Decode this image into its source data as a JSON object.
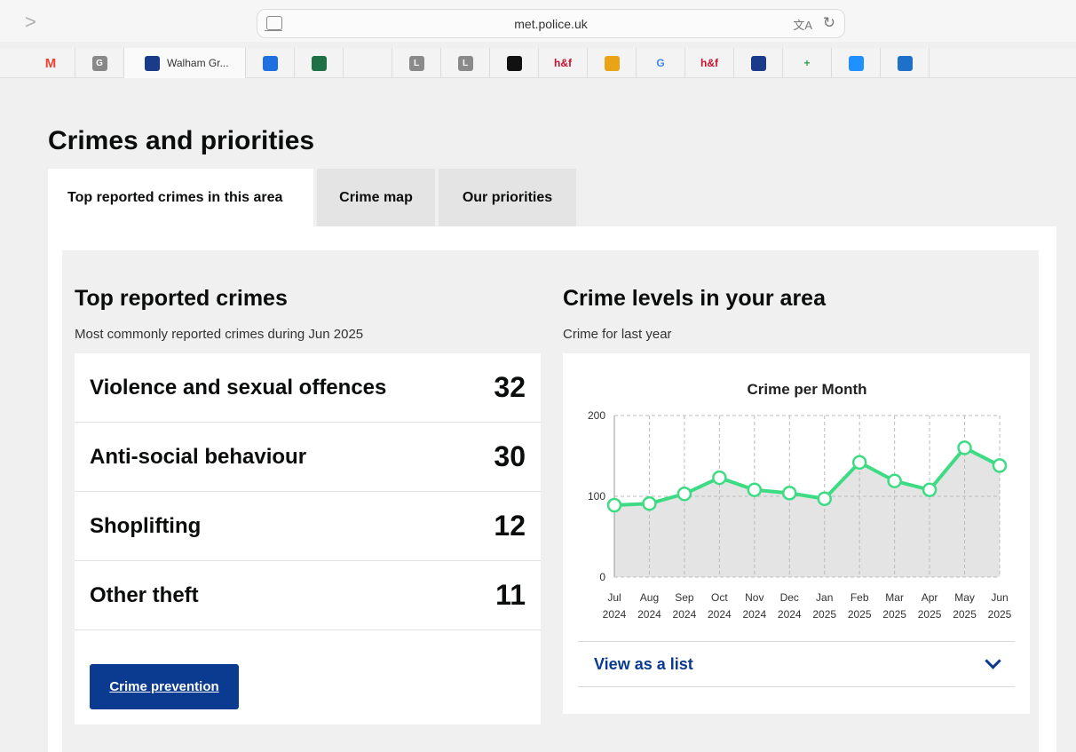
{
  "browser": {
    "url": "met.police.uk",
    "bookmarks": [
      {
        "icon": "gmail-icon",
        "label": "M",
        "color": "#ea4335",
        "text_color": "#ea4335",
        "bg": "transparent"
      },
      {
        "icon": "g-letter-icon",
        "label": "G",
        "color": "#888888"
      },
      {
        "icon": "walham-green-icon",
        "label": "Walham Gr...",
        "color": "#1a3a8a",
        "wide": true
      },
      {
        "icon": "dropbox-icon",
        "label": "",
        "color": "#1f6fe0"
      },
      {
        "icon": "excel-icon",
        "label": "",
        "color": "#1e7145"
      },
      {
        "icon": "blank",
        "label": "",
        "empty": true
      },
      {
        "icon": "l-letter-icon",
        "label": "L",
        "color": "#8a8a8a"
      },
      {
        "icon": "l-letter-icon",
        "label": "L",
        "color": "#8a8a8a"
      },
      {
        "icon": "crest-icon",
        "label": "",
        "color": "#111111"
      },
      {
        "icon": "hf-icon",
        "label": "h&f",
        "color": "#c8102e",
        "text": true
      },
      {
        "icon": "chrome-icon",
        "label": "",
        "color": "#e8a317"
      },
      {
        "icon": "google-icon",
        "label": "G",
        "color": "#4285f4",
        "text": true
      },
      {
        "icon": "hf-icon",
        "label": "h&f",
        "color": "#c8102e",
        "text": true
      },
      {
        "icon": "nhs-icon",
        "label": "",
        "color": "#1a3a8a"
      },
      {
        "icon": "plus-icon",
        "label": "+",
        "color": "#2ea44f",
        "text": true
      },
      {
        "icon": "minus-icon",
        "label": "",
        "color": "#1e90ff"
      },
      {
        "icon": "crown-icon",
        "label": "",
        "color": "#1e70c8"
      }
    ]
  },
  "page": {
    "heading": "Crimes and priorities",
    "tabs": [
      {
        "label": "Top reported crimes in this area",
        "active": true
      },
      {
        "label": "Crime map",
        "active": false
      },
      {
        "label": "Our priorities",
        "active": false
      }
    ]
  },
  "top_crimes": {
    "title": "Top reported crimes",
    "subtitle": "Most commonly reported crimes during Jun 2025",
    "items": [
      {
        "name": "Violence and sexual offences",
        "count": "32"
      },
      {
        "name": "Anti-social behaviour",
        "count": "30"
      },
      {
        "name": "Shoplifting",
        "count": "12"
      },
      {
        "name": "Other theft",
        "count": "11"
      }
    ],
    "button_label": "Crime prevention"
  },
  "crime_levels": {
    "title": "Crime levels in your area",
    "subtitle": "Crime for last year",
    "toggle_label": "View as a list"
  },
  "chart_data": {
    "type": "area",
    "title": "Crime per Month",
    "categories": [
      [
        "Jul",
        "2024"
      ],
      [
        "Aug",
        "2024"
      ],
      [
        "Sep",
        "2024"
      ],
      [
        "Oct",
        "2024"
      ],
      [
        "Nov",
        "2024"
      ],
      [
        "Dec",
        "2024"
      ],
      [
        "Jan",
        "2025"
      ],
      [
        "Feb",
        "2025"
      ],
      [
        "Mar",
        "2025"
      ],
      [
        "Apr",
        "2025"
      ],
      [
        "May",
        "2025"
      ],
      [
        "Jun",
        "2025"
      ]
    ],
    "values": [
      89,
      91,
      103,
      123,
      108,
      104,
      97,
      142,
      119,
      108,
      160,
      138
    ],
    "yticks": [
      0,
      100,
      200
    ],
    "ylim": [
      0,
      200
    ],
    "line_color": "#3ddc84",
    "fill_color": "#e4e4e4",
    "grid": true
  }
}
